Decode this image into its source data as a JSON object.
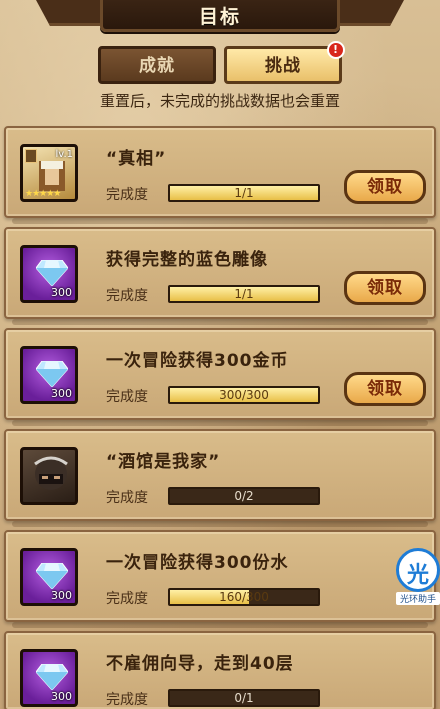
{
  "header": {
    "title": "目标"
  },
  "tabs": [
    {
      "label": "成就",
      "active": false
    },
    {
      "label": "挑战",
      "active": true,
      "badge": "!"
    }
  ],
  "notice": "重置后，未完成的挑战数据也会重置",
  "progress_label": "完成度",
  "claim_label": "领取",
  "challenges": [
    {
      "title": "“真相”",
      "icon": "hero-portrait-icon",
      "level": "lv.1",
      "stars": "★★★★★",
      "progress": "1/1",
      "fraction": 1.0,
      "claimable": true
    },
    {
      "title": "获得完整的蓝色雕像",
      "icon": "diamond-icon",
      "amount": "300",
      "progress": "1/1",
      "fraction": 1.0,
      "claimable": true
    },
    {
      "title": "一次冒险获得300金币",
      "icon": "diamond-icon",
      "amount": "300",
      "progress": "300/300",
      "fraction": 1.0,
      "claimable": true
    },
    {
      "title": "“酒馆是我家”",
      "icon": "hero-portrait-icon",
      "progress": "0/2",
      "fraction": 0.0,
      "claimable": false
    },
    {
      "title": "一次冒险获得300份水",
      "icon": "diamond-icon",
      "amount": "300",
      "progress": "160/300",
      "fraction": 0.533,
      "claimable": false
    },
    {
      "title": "不雇佣向导，走到40层",
      "icon": "diamond-icon",
      "amount": "300",
      "progress": "0/1",
      "fraction": 0.0,
      "claimable": false
    }
  ],
  "assistant": {
    "char": "光",
    "label": "光环助手"
  },
  "colors": {
    "gem": "#8a3ec0",
    "bar_fill": "#e8bf47",
    "claim": "#e9a94a",
    "badge": "#d8261b"
  }
}
